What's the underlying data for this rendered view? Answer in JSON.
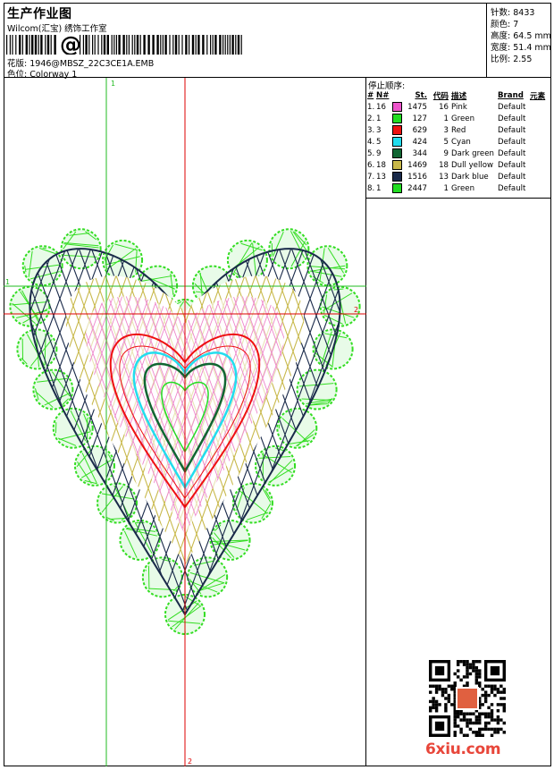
{
  "header": {
    "title": "生产作业图",
    "subtitle": "Wilcom(汇宝) 绣饰工作室",
    "barcode_glyph": "@",
    "design_label": "花版:",
    "design_value": "1946@MBSZ_22C3CE1A.EMB",
    "colorway_label": "色位:",
    "colorway_value": "Colorway 1"
  },
  "specs": [
    {
      "label": "针数:",
      "value": "8433"
    },
    {
      "label": "颜色:",
      "value": "7"
    },
    {
      "label": "高度:",
      "value": "64.5 mm"
    },
    {
      "label": "宽度:",
      "value": "51.4 mm"
    },
    {
      "label": "比例:",
      "value": "2.55"
    }
  ],
  "stop_sequence": {
    "title": "停止顺序:",
    "columns": [
      "#",
      "N#",
      "St.",
      "代码",
      "描述",
      "Brand",
      "元素"
    ],
    "rows": [
      {
        "idx": "1.",
        "n": "16",
        "color": "#ee55cc",
        "st": "1475",
        "code": "16",
        "desc": "Pink",
        "brand": "Default"
      },
      {
        "idx": "2.",
        "n": "1",
        "color": "#22dd22",
        "st": "127",
        "code": "1",
        "desc": "Green",
        "brand": "Default"
      },
      {
        "idx": "3.",
        "n": "3",
        "color": "#ee1111",
        "st": "629",
        "code": "3",
        "desc": "Red",
        "brand": "Default"
      },
      {
        "idx": "4.",
        "n": "5",
        "color": "#22ddee",
        "st": "424",
        "code": "5",
        "desc": "Cyan",
        "brand": "Default"
      },
      {
        "idx": "5.",
        "n": "9",
        "color": "#116633",
        "st": "344",
        "code": "9",
        "desc": "Dark green",
        "brand": "Default"
      },
      {
        "idx": "6.",
        "n": "18",
        "color": "#c8b84a",
        "st": "1469",
        "code": "18",
        "desc": "Dull yellow",
        "brand": "Default"
      },
      {
        "idx": "7.",
        "n": "13",
        "color": "#1a2a4a",
        "st": "1516",
        "code": "13",
        "desc": "Dark blue",
        "brand": "Default"
      },
      {
        "idx": "8.",
        "n": "1",
        "color": "#22dd22",
        "st": "2447",
        "code": "1",
        "desc": "Green",
        "brand": "Default"
      }
    ]
  },
  "guides": {
    "top": "1",
    "left": "1",
    "right": "2",
    "bottom": "2"
  },
  "watermark": "6xiu.com"
}
